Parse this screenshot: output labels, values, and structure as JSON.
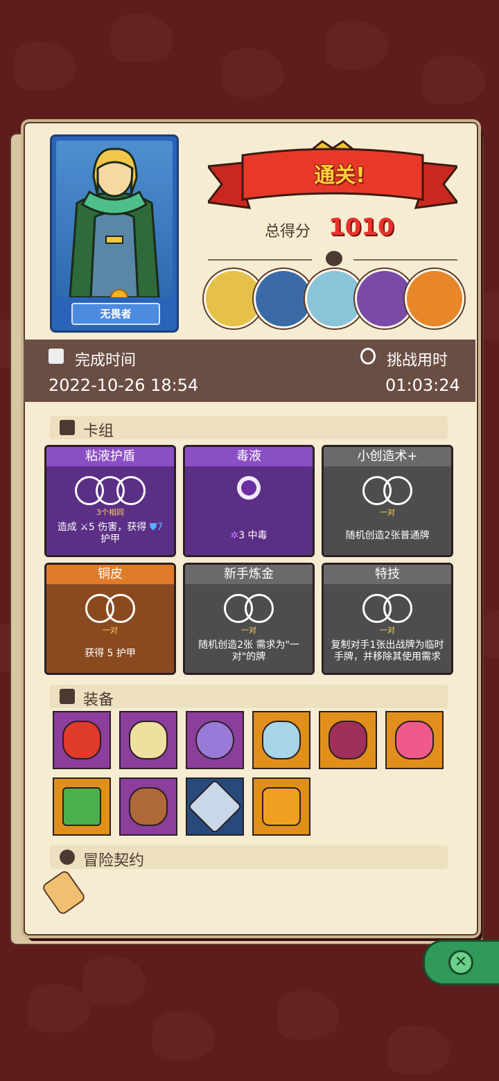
{
  "hero": {
    "name": "无畏者"
  },
  "result": {
    "title": "通关!",
    "score_label": "总得分",
    "score_value": "1010"
  },
  "stats": {
    "finish_label": "完成时间",
    "finish_value": "2022-10-26  18:54",
    "duration_label": "挑战用时",
    "duration_value": "01:03:24"
  },
  "deck": {
    "section_label": "卡组",
    "cards": [
      {
        "title": "粘液护盾",
        "color": "purple",
        "req": "3个相同",
        "desc_a": "造成 ",
        "desc_b": "5 伤害，获得 ",
        "desc_c": "7",
        "desc_d": "护甲"
      },
      {
        "title": "毒液",
        "color": "purple",
        "req": "",
        "desc": "3  中毒"
      },
      {
        "title": "小创造术+",
        "color": "gray",
        "req": "一对",
        "desc": "随机创造2张普通牌"
      },
      {
        "title": "铜皮",
        "color": "orange",
        "req": "一对",
        "desc": "获得 5 护甲"
      },
      {
        "title": "新手炼金",
        "color": "gray",
        "req": "一对",
        "desc": "随机创造2张 需求为\"一对\"的牌"
      },
      {
        "title": "特技",
        "color": "gray",
        "req": "一对",
        "desc": "复制对手1张出战牌为临时手牌，并移除其使用需求"
      }
    ]
  },
  "equipment": {
    "section_label": "装备",
    "items": [
      {
        "icon": "potion-bag-icon",
        "color": "#8c3e9c"
      },
      {
        "icon": "twin-blades-icon",
        "color": "#8c3e9c"
      },
      {
        "icon": "gem-ring-icon",
        "color": "#8c3e9c"
      },
      {
        "icon": "horn-icon",
        "color": "#e0901a"
      },
      {
        "icon": "heart-charm-icon",
        "color": "#e0901a"
      },
      {
        "icon": "fire-feather-icon",
        "color": "#e0901a"
      },
      {
        "icon": "moss-tablet-icon",
        "color": "#e0901a"
      },
      {
        "icon": "leather-armor-icon",
        "color": "#8c3e9c"
      },
      {
        "icon": "ice-crystal-icon",
        "color": "#274a7a"
      },
      {
        "icon": "knit-sweater-icon",
        "color": "#e0901a"
      }
    ]
  },
  "contract": {
    "section_label": "冒险契约"
  },
  "close": {
    "label": "✕"
  }
}
